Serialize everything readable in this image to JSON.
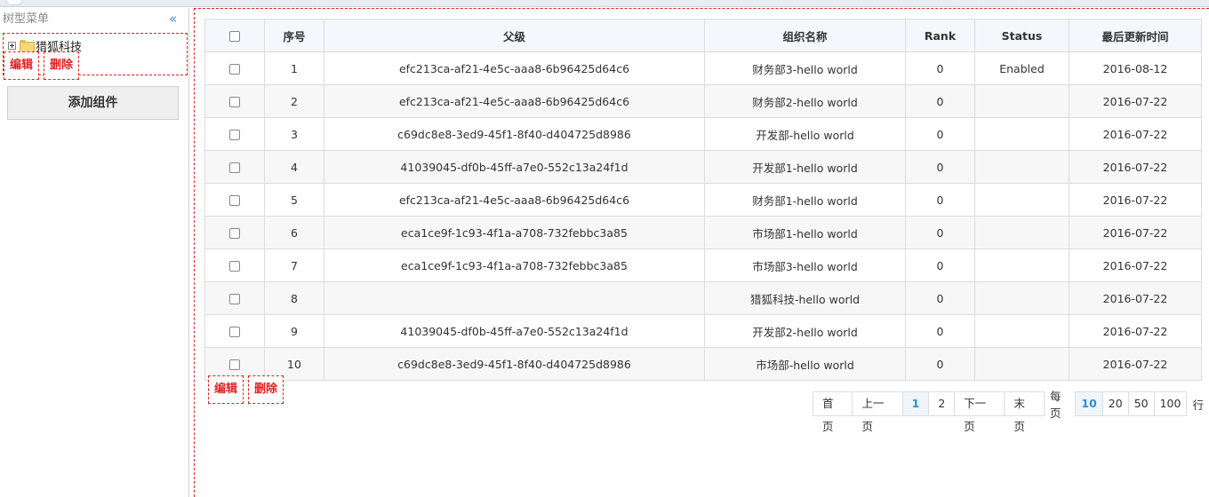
{
  "sidebar": {
    "title": "树型菜单",
    "collapse_icon": "«",
    "tree_root": "猎狐科技",
    "edit_label": "编辑",
    "delete_label": "删除",
    "add_label": "添加组件"
  },
  "table": {
    "headers": [
      "序号",
      "父级",
      "组织名称",
      "Rank",
      "Status",
      "最后更新时间"
    ],
    "rows": [
      {
        "no": "1",
        "parent": "efc213ca-af21-4e5c-aaa8-6b96425d64c6",
        "name": "财务部3-hello world",
        "rank": "0",
        "status": "Enabled",
        "updated": "2016-08-12"
      },
      {
        "no": "2",
        "parent": "efc213ca-af21-4e5c-aaa8-6b96425d64c6",
        "name": "财务部2-hello world",
        "rank": "0",
        "status": "",
        "updated": "2016-07-22"
      },
      {
        "no": "3",
        "parent": "c69dc8e8-3ed9-45f1-8f40-d404725d8986",
        "name": "开发部-hello world",
        "rank": "0",
        "status": "",
        "updated": "2016-07-22"
      },
      {
        "no": "4",
        "parent": "41039045-df0b-45ff-a7e0-552c13a24f1d",
        "name": "开发部1-hello world",
        "rank": "0",
        "status": "",
        "updated": "2016-07-22"
      },
      {
        "no": "5",
        "parent": "efc213ca-af21-4e5c-aaa8-6b96425d64c6",
        "name": "财务部1-hello world",
        "rank": "0",
        "status": "",
        "updated": "2016-07-22"
      },
      {
        "no": "6",
        "parent": "eca1ce9f-1c93-4f1a-a708-732febbc3a85",
        "name": "市场部1-hello world",
        "rank": "0",
        "status": "",
        "updated": "2016-07-22"
      },
      {
        "no": "7",
        "parent": "eca1ce9f-1c93-4f1a-a708-732febbc3a85",
        "name": "市场部3-hello world",
        "rank": "0",
        "status": "",
        "updated": "2016-07-22"
      },
      {
        "no": "8",
        "parent": "",
        "name": "猎狐科技-hello world",
        "rank": "0",
        "status": "",
        "updated": "2016-07-22"
      },
      {
        "no": "9",
        "parent": "41039045-df0b-45ff-a7e0-552c13a24f1d",
        "name": "开发部2-hello world",
        "rank": "0",
        "status": "",
        "updated": "2016-07-22"
      },
      {
        "no": "10",
        "parent": "c69dc8e8-3ed9-45f1-8f40-d404725d8986",
        "name": "市场部-hello world",
        "rank": "0",
        "status": "",
        "updated": "2016-07-22"
      }
    ]
  },
  "actions": {
    "edit_label": "编辑",
    "delete_label": "删除"
  },
  "pager": {
    "first": "首页",
    "prev": "上一页",
    "pages": [
      "1",
      "2"
    ],
    "current": "1",
    "next": "下一页",
    "last": "末页",
    "per_page_label": "每页",
    "sizes": [
      "10",
      "20",
      "50",
      "100"
    ],
    "current_size": "10",
    "rows_label": "行"
  }
}
